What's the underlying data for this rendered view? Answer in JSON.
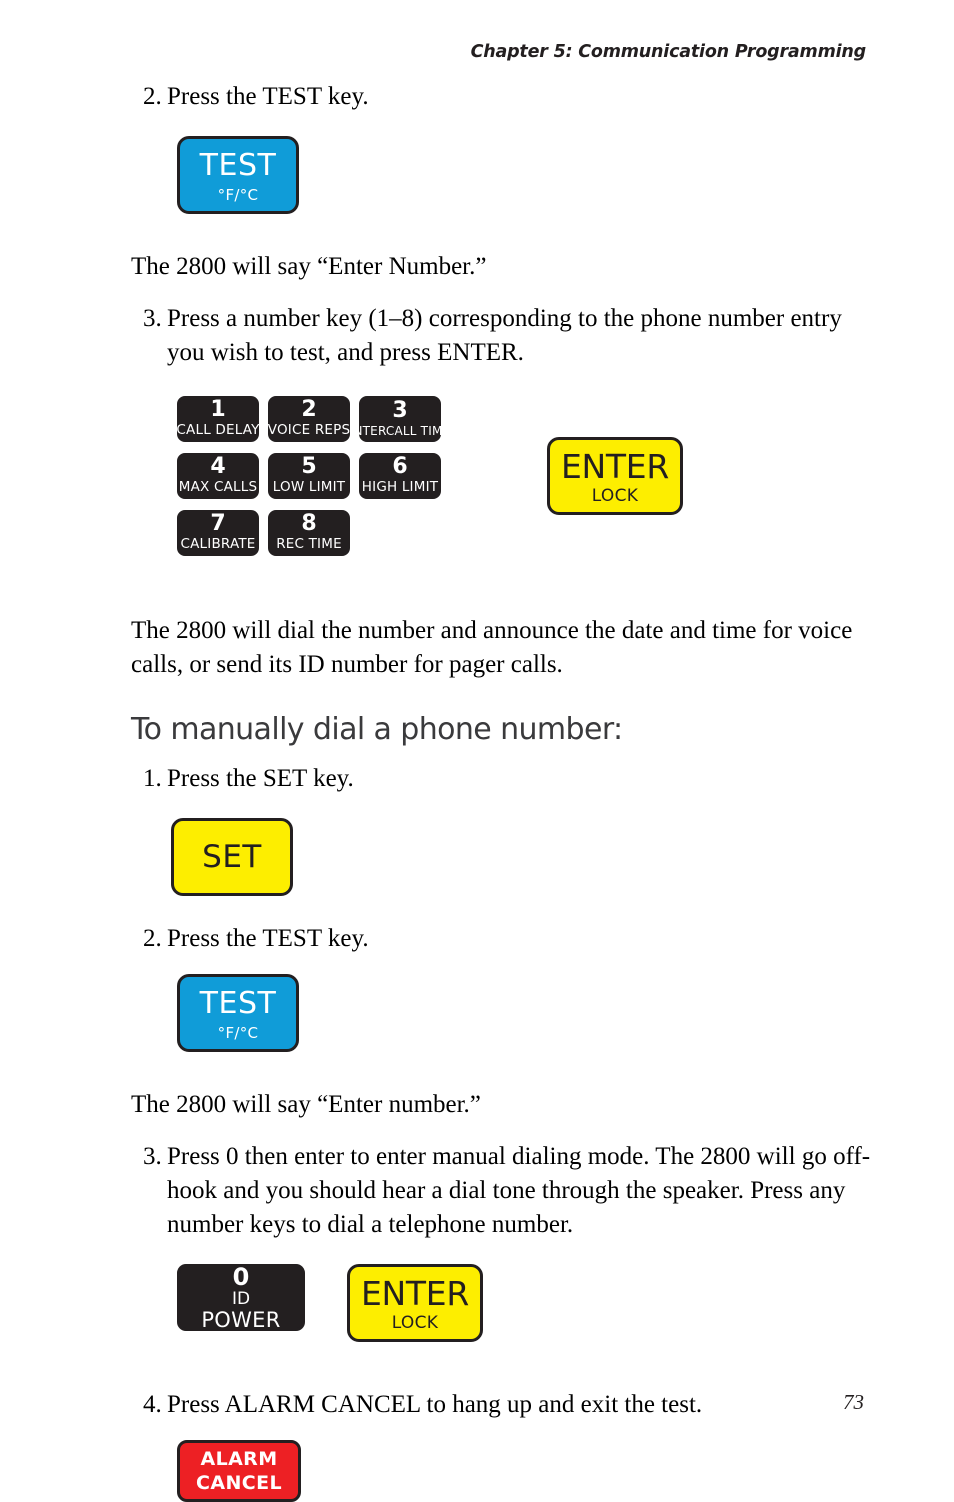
{
  "page": {
    "running_head": "Chapter 5: Communication Programming",
    "folio": "73"
  },
  "section_one": {
    "step2": {
      "num": "2.",
      "text": "Press the TEST key."
    },
    "test_key": {
      "main": "TEST",
      "sub": "°F/°C"
    },
    "para_enter_number": "The 2800 will say “Enter Number.”",
    "step3": {
      "num": "3.",
      "text": "Press a number key (1–8) corresponding to the phone number entry you wish to test, and press ENTER."
    },
    "keypad": [
      {
        "main": "1",
        "sub": "CALL DELAY"
      },
      {
        "main": "2",
        "sub": "VOICE REPS"
      },
      {
        "main": "3",
        "sub": "INTERCALL TIME"
      },
      {
        "main": "4",
        "sub": "MAX CALLS"
      },
      {
        "main": "5",
        "sub": "LOW LIMIT"
      },
      {
        "main": "6",
        "sub": "HIGH LIMIT"
      },
      {
        "main": "7",
        "sub": "CALIBRATE"
      },
      {
        "main": "8",
        "sub": "REC TIME"
      }
    ],
    "enter_key": {
      "main": "ENTER",
      "sub": "LOCK"
    },
    "para_dial": "The 2800 will dial the number and announce the date and time for voice calls, or send its ID number for pager calls."
  },
  "section_two": {
    "heading": "To manually dial a phone number:",
    "step1": {
      "num": "1.",
      "text": "Press the SET key."
    },
    "set_key": {
      "main": "SET"
    },
    "step2": {
      "num": "2.",
      "text": "Press the TEST key."
    },
    "test_key": {
      "main": "TEST",
      "sub": "°F/°C"
    },
    "para_enter_number": "The 2800 will say “Enter number.”",
    "step3": {
      "num": "3.",
      "text": "Press 0 then enter to enter manual dialing mode. The 2800 will go off-hook and you should hear a dial tone through the speaker. Press any number keys to dial a telephone number."
    },
    "zero_key": {
      "main": "0",
      "sub1": "ID",
      "sub2": "POWER"
    },
    "enter_key": {
      "main": "ENTER",
      "sub": "LOCK"
    },
    "step4": {
      "num": "4.",
      "text": "Press ALARM CANCEL to hang up and exit the test."
    },
    "alarm_key": {
      "main": "ALARM",
      "sub": "CANCEL"
    }
  },
  "colors": {
    "test_blue": "#109cd8",
    "key_yellow": "#fdee00",
    "alarm_red": "#ed2024",
    "key_black": "#231f20",
    "heading_gray": "#3a3a3c"
  }
}
